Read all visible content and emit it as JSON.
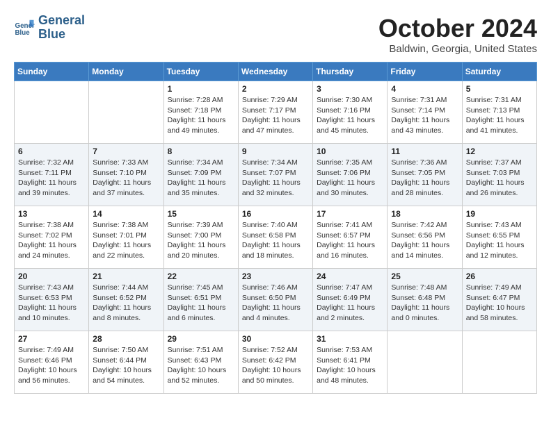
{
  "header": {
    "logo_line1": "General",
    "logo_line2": "Blue",
    "month": "October 2024",
    "location": "Baldwin, Georgia, United States"
  },
  "weekdays": [
    "Sunday",
    "Monday",
    "Tuesday",
    "Wednesday",
    "Thursday",
    "Friday",
    "Saturday"
  ],
  "weeks": [
    [
      {
        "day": "",
        "detail": ""
      },
      {
        "day": "",
        "detail": ""
      },
      {
        "day": "1",
        "detail": "Sunrise: 7:28 AM\nSunset: 7:18 PM\nDaylight: 11 hours and 49 minutes."
      },
      {
        "day": "2",
        "detail": "Sunrise: 7:29 AM\nSunset: 7:17 PM\nDaylight: 11 hours and 47 minutes."
      },
      {
        "day": "3",
        "detail": "Sunrise: 7:30 AM\nSunset: 7:16 PM\nDaylight: 11 hours and 45 minutes."
      },
      {
        "day": "4",
        "detail": "Sunrise: 7:31 AM\nSunset: 7:14 PM\nDaylight: 11 hours and 43 minutes."
      },
      {
        "day": "5",
        "detail": "Sunrise: 7:31 AM\nSunset: 7:13 PM\nDaylight: 11 hours and 41 minutes."
      }
    ],
    [
      {
        "day": "6",
        "detail": "Sunrise: 7:32 AM\nSunset: 7:11 PM\nDaylight: 11 hours and 39 minutes."
      },
      {
        "day": "7",
        "detail": "Sunrise: 7:33 AM\nSunset: 7:10 PM\nDaylight: 11 hours and 37 minutes."
      },
      {
        "day": "8",
        "detail": "Sunrise: 7:34 AM\nSunset: 7:09 PM\nDaylight: 11 hours and 35 minutes."
      },
      {
        "day": "9",
        "detail": "Sunrise: 7:34 AM\nSunset: 7:07 PM\nDaylight: 11 hours and 32 minutes."
      },
      {
        "day": "10",
        "detail": "Sunrise: 7:35 AM\nSunset: 7:06 PM\nDaylight: 11 hours and 30 minutes."
      },
      {
        "day": "11",
        "detail": "Sunrise: 7:36 AM\nSunset: 7:05 PM\nDaylight: 11 hours and 28 minutes."
      },
      {
        "day": "12",
        "detail": "Sunrise: 7:37 AM\nSunset: 7:03 PM\nDaylight: 11 hours and 26 minutes."
      }
    ],
    [
      {
        "day": "13",
        "detail": "Sunrise: 7:38 AM\nSunset: 7:02 PM\nDaylight: 11 hours and 24 minutes."
      },
      {
        "day": "14",
        "detail": "Sunrise: 7:38 AM\nSunset: 7:01 PM\nDaylight: 11 hours and 22 minutes."
      },
      {
        "day": "15",
        "detail": "Sunrise: 7:39 AM\nSunset: 7:00 PM\nDaylight: 11 hours and 20 minutes."
      },
      {
        "day": "16",
        "detail": "Sunrise: 7:40 AM\nSunset: 6:58 PM\nDaylight: 11 hours and 18 minutes."
      },
      {
        "day": "17",
        "detail": "Sunrise: 7:41 AM\nSunset: 6:57 PM\nDaylight: 11 hours and 16 minutes."
      },
      {
        "day": "18",
        "detail": "Sunrise: 7:42 AM\nSunset: 6:56 PM\nDaylight: 11 hours and 14 minutes."
      },
      {
        "day": "19",
        "detail": "Sunrise: 7:43 AM\nSunset: 6:55 PM\nDaylight: 11 hours and 12 minutes."
      }
    ],
    [
      {
        "day": "20",
        "detail": "Sunrise: 7:43 AM\nSunset: 6:53 PM\nDaylight: 11 hours and 10 minutes."
      },
      {
        "day": "21",
        "detail": "Sunrise: 7:44 AM\nSunset: 6:52 PM\nDaylight: 11 hours and 8 minutes."
      },
      {
        "day": "22",
        "detail": "Sunrise: 7:45 AM\nSunset: 6:51 PM\nDaylight: 11 hours and 6 minutes."
      },
      {
        "day": "23",
        "detail": "Sunrise: 7:46 AM\nSunset: 6:50 PM\nDaylight: 11 hours and 4 minutes."
      },
      {
        "day": "24",
        "detail": "Sunrise: 7:47 AM\nSunset: 6:49 PM\nDaylight: 11 hours and 2 minutes."
      },
      {
        "day": "25",
        "detail": "Sunrise: 7:48 AM\nSunset: 6:48 PM\nDaylight: 11 hours and 0 minutes."
      },
      {
        "day": "26",
        "detail": "Sunrise: 7:49 AM\nSunset: 6:47 PM\nDaylight: 10 hours and 58 minutes."
      }
    ],
    [
      {
        "day": "27",
        "detail": "Sunrise: 7:49 AM\nSunset: 6:46 PM\nDaylight: 10 hours and 56 minutes."
      },
      {
        "day": "28",
        "detail": "Sunrise: 7:50 AM\nSunset: 6:44 PM\nDaylight: 10 hours and 54 minutes."
      },
      {
        "day": "29",
        "detail": "Sunrise: 7:51 AM\nSunset: 6:43 PM\nDaylight: 10 hours and 52 minutes."
      },
      {
        "day": "30",
        "detail": "Sunrise: 7:52 AM\nSunset: 6:42 PM\nDaylight: 10 hours and 50 minutes."
      },
      {
        "day": "31",
        "detail": "Sunrise: 7:53 AM\nSunset: 6:41 PM\nDaylight: 10 hours and 48 minutes."
      },
      {
        "day": "",
        "detail": ""
      },
      {
        "day": "",
        "detail": ""
      }
    ]
  ]
}
